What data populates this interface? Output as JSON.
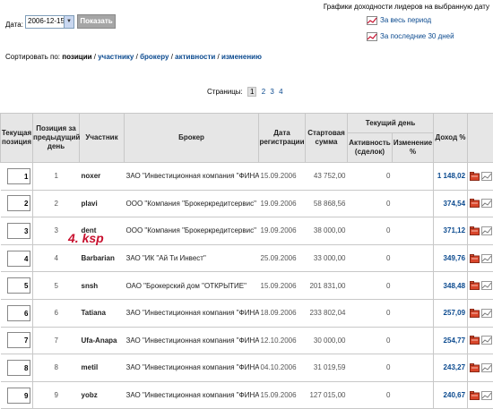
{
  "filter": {
    "date_label": "Дата:",
    "date_value": "2006-12-15",
    "show_button": "Показать"
  },
  "charts": {
    "title": "Графики доходности лидеров на выбранную дату",
    "link_all": "За весь период",
    "link_30": "За последние 30 дней"
  },
  "sort": {
    "label": "Сортировать по:",
    "options": [
      "позиции",
      "участнику",
      "брокеру",
      "активности",
      "изменению"
    ],
    "sep": "/"
  },
  "pagination": {
    "label": "Страницы:",
    "pages": [
      "1",
      "2",
      "3",
      "4"
    ],
    "current": "1"
  },
  "table": {
    "headers": {
      "pos": "Текущая позиция",
      "prev": "Позиция за предыдущий день",
      "user": "Участник",
      "broker": "Брокер",
      "date": "Дата регистрации",
      "start": "Стартовая сумма",
      "day": "Текущий день",
      "activity": "Активность (сделок)",
      "change": "Изменение %",
      "income": "Доход %"
    },
    "rows": [
      {
        "pos": "1",
        "prev": "1",
        "user": "noxer",
        "broker": "ЗАО \"Инвестиционная компания \"ФИНАМ\"",
        "date": "15.09.2006",
        "start": "43 752,00",
        "activity": "0",
        "change": "",
        "income": "1 148,02"
      },
      {
        "pos": "2",
        "prev": "2",
        "user": "plavi",
        "broker": "ООО \"Компания \"Брокеркредитсервис\"",
        "date": "19.09.2006",
        "start": "58 868,56",
        "activity": "0",
        "change": "",
        "income": "374,54"
      },
      {
        "pos": "3",
        "prev": "3",
        "user": "dent",
        "broker": "ООО \"Компания \"Брокеркредитсервис\"",
        "date": "19.09.2006",
        "start": "38 000,00",
        "activity": "0",
        "change": "",
        "income": "371,12"
      },
      {
        "pos": "4",
        "prev": "4",
        "user": "Barbarian",
        "broker": "ЗАО \"ИК \"Ай Ти Инвест\"",
        "date": "25.09.2006",
        "start": "33 000,00",
        "activity": "0",
        "change": "",
        "income": "349,76"
      },
      {
        "pos": "5",
        "prev": "5",
        "user": "snsh",
        "broker": "ОАО \"Брокерский дом \"ОТКРЫТИЕ\"",
        "date": "15.09.2006",
        "start": "201 831,00",
        "activity": "0",
        "change": "",
        "income": "348,48"
      },
      {
        "pos": "6",
        "prev": "6",
        "user": "Tatiana",
        "broker": "ЗАО \"Инвестиционная компания \"ФИНАМ\"",
        "date": "18.09.2006",
        "start": "233 802,04",
        "activity": "0",
        "change": "",
        "income": "257,09"
      },
      {
        "pos": "7",
        "prev": "7",
        "user": "Ufa-Anapa",
        "broker": "ЗАО \"Инвестиционная компания \"ФИНАМ\"",
        "date": "12.10.2006",
        "start": "30 000,00",
        "activity": "0",
        "change": "",
        "income": "254,77"
      },
      {
        "pos": "8",
        "prev": "8",
        "user": "metil",
        "broker": "ЗАО \"Инвестиционная компания \"ФИНАМ\"",
        "date": "04.10.2006",
        "start": "31 019,59",
        "activity": "0",
        "change": "",
        "income": "243,27"
      },
      {
        "pos": "9",
        "prev": "9",
        "user": "yobz",
        "broker": "ЗАО \"Инвестиционная компания \"ФИНАМ\"",
        "date": "15.09.2006",
        "start": "127 015,00",
        "activity": "0",
        "change": "",
        "income": "240,67"
      }
    ]
  },
  "annotation": "4. ksp",
  "colors": {
    "link": "#0b4a8f",
    "annotation": "#c8102e",
    "header_bg": "#e6e6e6"
  },
  "icons": {
    "row_folder": "folder-icon",
    "row_chart": "chart-icon",
    "link_chart": "line-chart-icon"
  }
}
